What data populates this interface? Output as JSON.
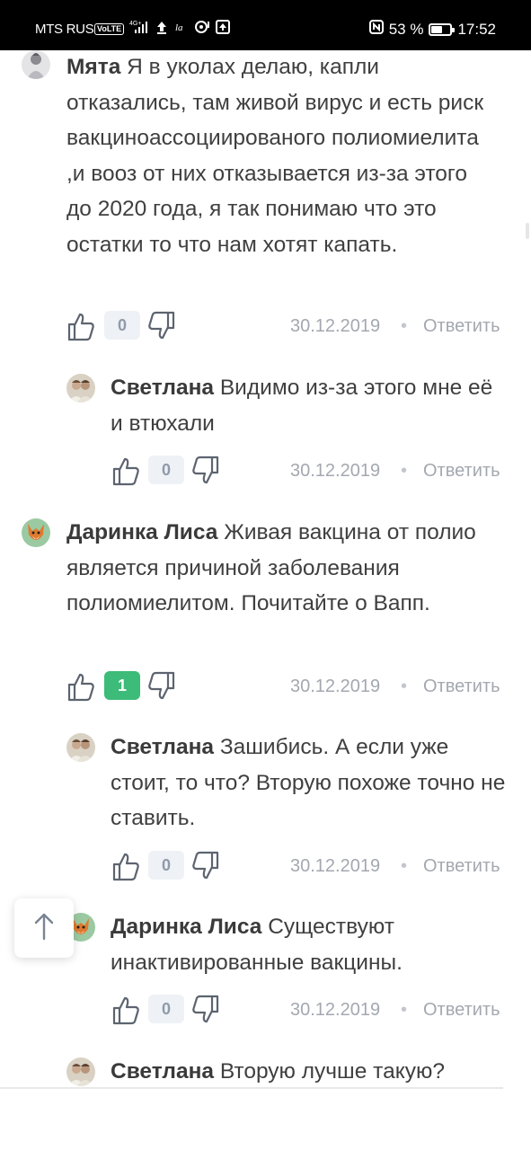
{
  "status_bar": {
    "carrier": "MTS RUS",
    "volte": "VoLTE",
    "network": "4G+",
    "battery": "53 %",
    "battery_level": 0.53,
    "time": "17:52"
  },
  "comments": [
    {
      "author": "Мята",
      "text": "Я в уколах делаю, капли отказались, там живой вирус и есть риск вакциноассоциированого полиомиелита ,и вооз от них отказывается из-за этого до 2020 года, я так понимаю что это остатки то что нам хотят капать.",
      "likes": "0",
      "date": "30.12.2019",
      "reply": "Ответить"
    },
    {
      "author": "Светлана",
      "text": "Видимо из-за этого мне её и втюхали",
      "likes": "0",
      "date": "30.12.2019",
      "reply": "Ответить"
    },
    {
      "author": "Даринка Лиса",
      "text": "Живая вакцина от полио является причиной заболевания полиомиелитом. Почитайте о Вапп.",
      "likes": "1",
      "date": "30.12.2019",
      "reply": "Ответить"
    },
    {
      "author": "Светлана",
      "text": "Зашибись. А если уже стоит, то что? Вторую похоже точно не ставить.",
      "likes": "0",
      "date": "30.12.2019",
      "reply": "Ответить"
    },
    {
      "author": "Даринка Лиса",
      "text": "Существуют инактивированные вакцины.",
      "likes": "0",
      "date": "30.12.2019",
      "reply": "Ответить"
    },
    {
      "author": "Светлана",
      "text": "Вторую лучше такую?"
    }
  ],
  "dot_separator": "•",
  "icons": {
    "like": "thumbs-up-icon",
    "dislike": "thumbs-down-icon",
    "scroll_top": "arrow-up-icon"
  },
  "colors": {
    "positive_badge": "#3dbb78",
    "neutral_badge": "#eef1f5",
    "meta_text": "#a3a8b0"
  }
}
